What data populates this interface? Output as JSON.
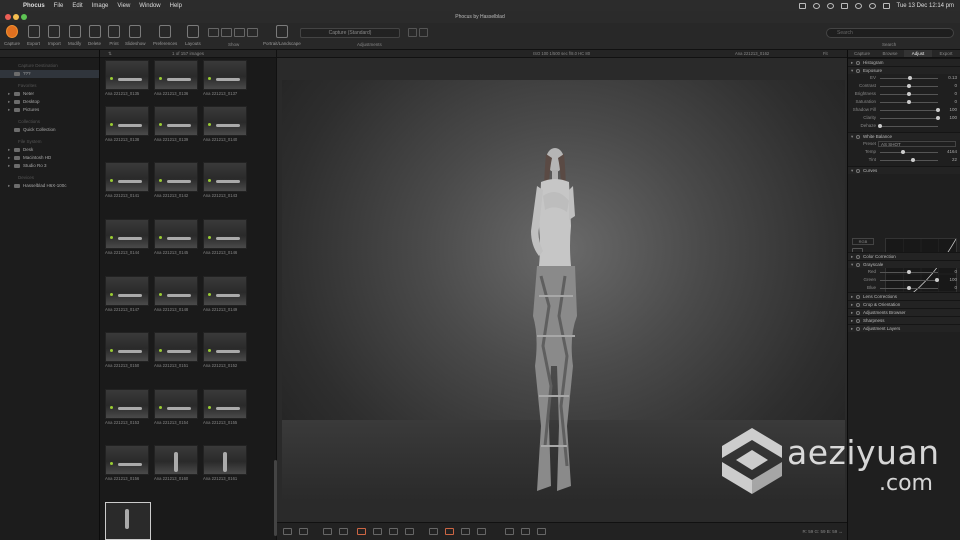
{
  "menubar": {
    "app_name": "Phocus",
    "items": [
      "File",
      "Edit",
      "Image",
      "View",
      "Window",
      "Help"
    ],
    "datetime": "Tue 13 Dec  12:14 pm"
  },
  "window": {
    "title": "Phocus by Hasselblad"
  },
  "toolbar": {
    "buttons": [
      "Capture",
      "Export",
      "Import",
      "Modify",
      "Delete",
      "Print",
      "Slideshow",
      "Preferences",
      "Layouts",
      "Portrait/Landscape"
    ],
    "show_label": "Show",
    "session": "Capture (Standard)",
    "adjustments_label": "Adjustments",
    "search_placeholder": "Search",
    "search_label": "Search"
  },
  "sidebar": {
    "top_label": "Capture Destination",
    "selected": "???",
    "sections": [
      {
        "title": "Favorites",
        "items": [
          "Neter",
          "Desktop",
          "Pictures"
        ]
      },
      {
        "title": "Collections",
        "items": [
          "Quick Collection"
        ]
      },
      {
        "title": "File System",
        "items": [
          "Desk",
          "Macintosh HD",
          "Studio Ro 3"
        ]
      },
      {
        "title": "Devices",
        "items": [
          "Hasselblad H6X-100c"
        ]
      }
    ]
  },
  "browser": {
    "count": "1 of 157 images",
    "thumbnails": [
      "Ana 221213_0135",
      "Ana 221213_0136",
      "Ana 221213_0137",
      "Ana 221213_0138",
      "Ana 221213_0139",
      "Ana 221213_0140",
      "Ana 221213_0141",
      "Ana 221213_0142",
      "Ana 221213_0143",
      "Ana 221213_0144",
      "Ana 221213_0145",
      "Ana 221213_0146",
      "Ana 221213_0147",
      "Ana 221213_0148",
      "Ana 221213_0149",
      "Ana 221213_0150",
      "Ana 221213_0151",
      "Ana 221213_0152",
      "Ana 221213_0153",
      "Ana 221213_0154",
      "Ana 221213_0155",
      "Ana 221213_0156",
      "Ana 221213_0160",
      "Ana 221213_0161",
      "Ana 221213_0162"
    ]
  },
  "viewer": {
    "meta": "ISO 100  1/500 sec  f/8.0  HC 80",
    "filename": "Ana 221213_0162",
    "zoom": "Fit",
    "coords": "R: 59  G: 59  B: 59 ↔"
  },
  "right_panel": {
    "tabs": [
      "Capture",
      "Browse",
      "Adjust",
      "Export"
    ],
    "active_tab": "Adjust",
    "sections": {
      "histogram": "Histogram",
      "exposure": {
        "title": "Exposure",
        "rows": [
          {
            "label": "EV",
            "value": "0.13",
            "pos": 0.52
          },
          {
            "label": "Contrast",
            "value": "0",
            "pos": 0.5
          },
          {
            "label": "Brightness",
            "value": "0",
            "pos": 0.5
          },
          {
            "label": "Saturation",
            "value": "0",
            "pos": 0.5
          },
          {
            "label": "Shadow Fill",
            "value": "100",
            "pos": 1.0
          },
          {
            "label": "Clarity",
            "value": "100",
            "pos": 1.0
          },
          {
            "label": "Dehaze",
            "value": "",
            "pos": 0.0
          }
        ]
      },
      "white_balance": {
        "title": "White Balance",
        "preset_label": "Preset",
        "preset": "AS SHOT",
        "rows": [
          {
            "label": "Temp",
            "value": "4164",
            "pos": 0.4
          },
          {
            "label": "Tint",
            "value": "22",
            "pos": 0.57
          }
        ]
      },
      "curves": {
        "title": "Curves",
        "channel": "RGB"
      },
      "color_correction": "Color Correction",
      "grayscale": {
        "title": "Grayscale",
        "rows": [
          {
            "label": "Red",
            "value": "0",
            "pos": 0.5
          },
          {
            "label": "Green",
            "value": "100",
            "pos": 0.98
          },
          {
            "label": "Blue",
            "value": "0",
            "pos": 0.5
          }
        ]
      },
      "rest": [
        "Lens Corrections",
        "Crop & Orientation",
        "Adjustments Browser",
        "Sharpness",
        "Adjustment Layers"
      ]
    }
  },
  "watermark": {
    "text": "aeziyuan",
    "domain": ".com"
  }
}
